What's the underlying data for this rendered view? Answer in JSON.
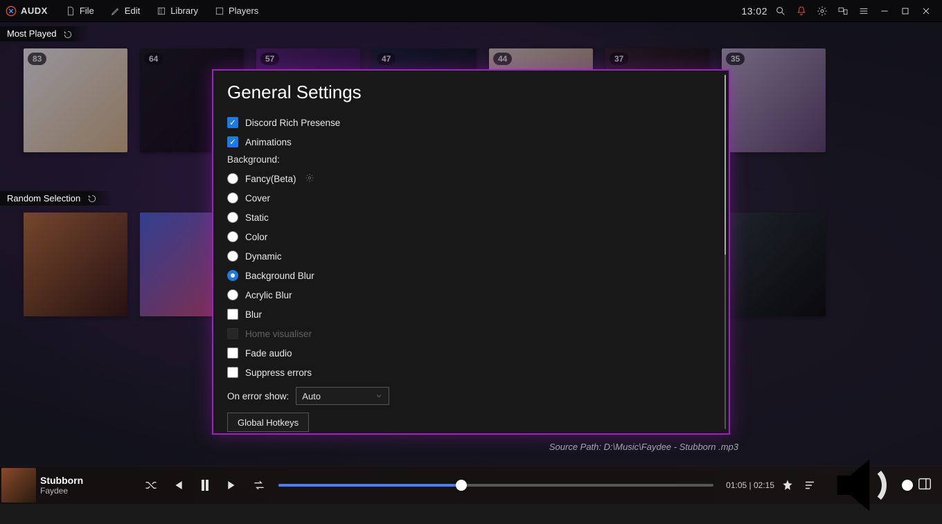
{
  "app_name": "AUDX",
  "menubar": {
    "file": "File",
    "edit": "Edit",
    "library": "Library",
    "players": "Players"
  },
  "clock": "13:02",
  "sections": {
    "most_played": "Most Played",
    "random_selection": "Random Selection"
  },
  "most_played_counts": [
    "83",
    "64",
    "57",
    "47",
    "44",
    "37",
    "35"
  ],
  "source_path": "Source Path: D:\\Music\\Faydee - Stubborn .mp3",
  "modal": {
    "title": "General Settings",
    "checkboxes": {
      "discord": {
        "label": "Discord Rich Presense",
        "checked": true
      },
      "animations": {
        "label": "Animations",
        "checked": true
      },
      "blur": {
        "label": "Blur",
        "checked": false
      },
      "home_visualiser": {
        "label": "Home visualiser",
        "checked": false,
        "disabled": true
      },
      "fade_audio": {
        "label": "Fade audio",
        "checked": false
      },
      "suppress_errors": {
        "label": "Suppress errors",
        "checked": false
      }
    },
    "background_label": "Background:",
    "radios": {
      "fancy": "Fancy(Beta)",
      "cover": "Cover",
      "static": "Static",
      "color": "Color",
      "dynamic": "Dynamic",
      "background_blur": "Background Blur",
      "acrylic_blur": "Acrylic Blur"
    },
    "radio_selected": "background_blur",
    "on_error_label": "On error show:",
    "on_error_value": "Auto",
    "global_hotkeys": "Global Hotkeys"
  },
  "player": {
    "title": "Stubborn",
    "artist": "Faydee",
    "elapsed": "01:05",
    "total": "02:15",
    "time_display": "01:05 | 02:15"
  }
}
